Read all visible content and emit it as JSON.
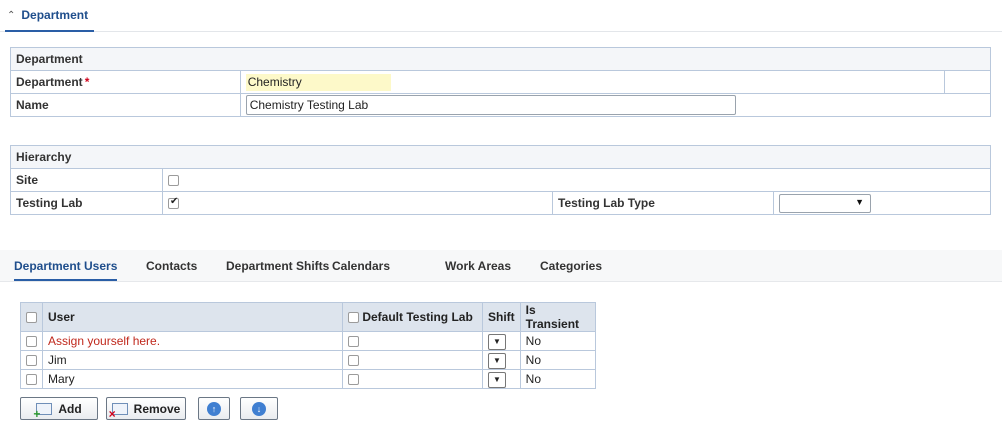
{
  "section": {
    "collapse_icon": "chevron-up-icon",
    "title": "Department"
  },
  "department_panel": {
    "caption": "Department",
    "department_label": "Department",
    "required_mark": "*",
    "department_value": "Chemistry",
    "name_label": "Name",
    "name_value": "Chemistry Testing Lab"
  },
  "hierarchy_panel": {
    "caption": "Hierarchy",
    "site_label": "Site",
    "site_checked": false,
    "testing_lab_label": "Testing Lab",
    "testing_lab_checked": true,
    "testing_lab_type_label": "Testing Lab Type",
    "testing_lab_type_value": ""
  },
  "tabs": [
    {
      "label": "Department Users",
      "active": true
    },
    {
      "label": "Contacts"
    },
    {
      "label": "Department Shifts"
    },
    {
      "label": "Calendars"
    },
    {
      "label": "Work Areas"
    },
    {
      "label": "Categories"
    }
  ],
  "users_table": {
    "headers": {
      "user": "User",
      "default_testing_lab": "Default Testing Lab",
      "shift": "Shift",
      "is_transient": "Is Transient"
    },
    "rows": [
      {
        "user": "Assign yourself here.",
        "is_transient": "No"
      },
      {
        "user": "Jim",
        "is_transient": "No"
      },
      {
        "user": "Mary",
        "is_transient": "No"
      }
    ]
  },
  "actions": {
    "add_label": "Add",
    "remove_label": "Remove",
    "move_up_icon": "arrow-up-circle-icon",
    "move_down_icon": "arrow-down-circle-icon"
  },
  "colors": {
    "accent": "#2a5ea6",
    "required": "#d0021b",
    "highlight": "#fdf9c9",
    "link_red": "#c0281c"
  }
}
